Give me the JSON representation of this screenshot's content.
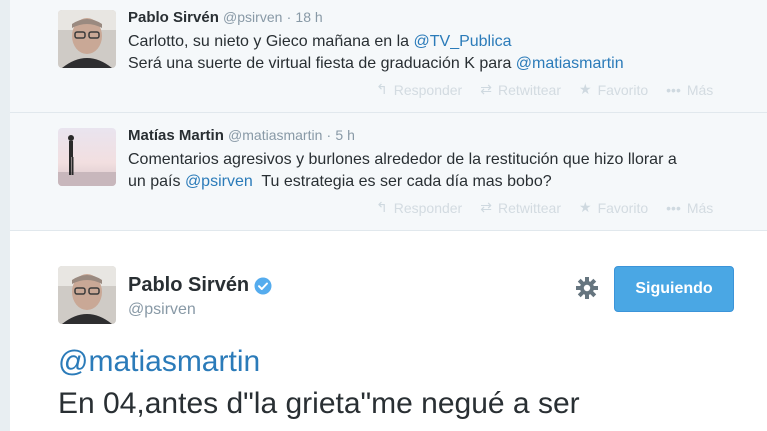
{
  "replies": [
    {
      "fullname": "Pablo Sirvén",
      "username": "@psirven",
      "time": "18 h",
      "lines": [
        [
          "Carlotto, su nieto y Gieco mañana en la ",
          "@TV_Publica",
          ""
        ],
        [
          "Será una suerte de virtual fiesta de graduación K para ",
          "@matiasmartin",
          ""
        ]
      ]
    },
    {
      "fullname": "Matías Martin",
      "username": "@matiasmartin",
      "time": "5 h",
      "lines": [
        [
          "Comentarios agresivos y burlones alrededor de la restitución que hizo llorar a",
          "",
          ""
        ],
        [
          "un país ",
          "@psirven",
          "  Tu estrategia es ser cada día mas bobo?"
        ]
      ]
    }
  ],
  "actions": {
    "reply": "Responder",
    "retweet": "Retwittear",
    "favorite": "Favorito",
    "more": "Más"
  },
  "main_tweet": {
    "fullname": "Pablo Sirvén",
    "username": "@psirven",
    "follow_label": "Siguiendo",
    "mention": "@matiasmartin",
    "text": "En 04,antes d\"la grieta\"me negué a ser"
  },
  "colors": {
    "link": "#2b7bb9",
    "follow_button": "#4aa7e4",
    "verified": "#55acee"
  },
  "icons": [
    "reply-icon",
    "retweet-icon",
    "favorite-icon",
    "more-icon",
    "gear-icon",
    "verified-badge-icon"
  ]
}
